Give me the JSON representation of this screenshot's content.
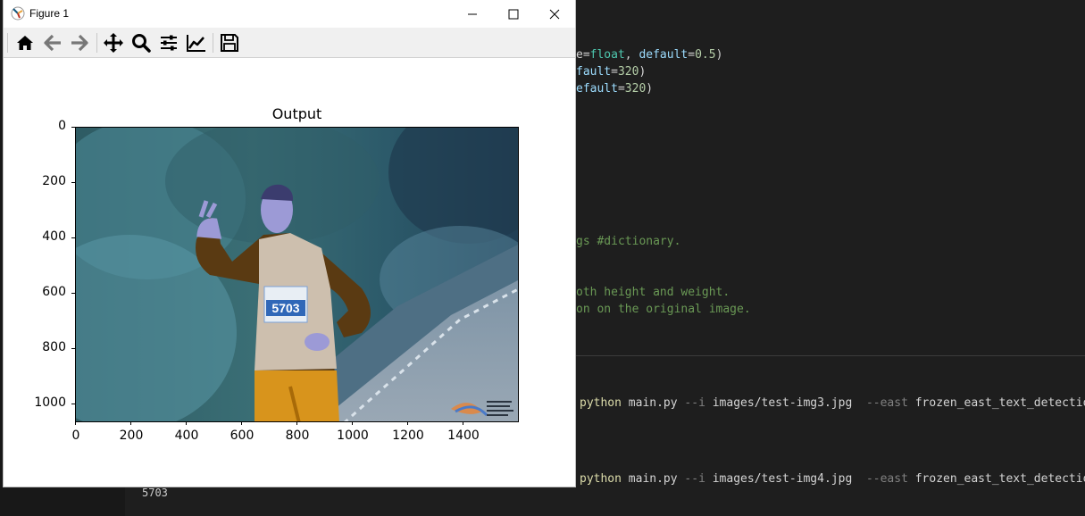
{
  "window": {
    "title": "Figure 1",
    "minimize_icon": "minimize-icon",
    "maximize_icon": "maximize-icon",
    "close_icon": "close-icon"
  },
  "toolbar": {
    "buttons": [
      "home-icon",
      "back-arrow-icon",
      "forward-arrow-icon",
      "pan-icon",
      "zoom-icon",
      "subplots-icon",
      "axes-edit-icon",
      "save-icon"
    ]
  },
  "plot": {
    "title": "Output",
    "yticks": [
      "0",
      "200",
      "400",
      "600",
      "800",
      "1000"
    ],
    "xticks": [
      "0",
      "200",
      "400",
      "600",
      "800",
      "1000",
      "1200",
      "1400"
    ],
    "bib_number": "5703"
  },
  "editor": {
    "lines": [
      {
        "parts": [
          [
            "e=",
            ""
          ],
          [
            "float",
            "kw"
          ],
          [
            ", ",
            ""
          ],
          [
            "default",
            "param"
          ],
          [
            "=",
            ""
          ],
          [
            "0.5",
            "num"
          ],
          [
            ")",
            ""
          ]
        ]
      },
      {
        "parts": [
          [
            "fault",
            "param"
          ],
          [
            "=",
            ""
          ],
          [
            "320",
            "num"
          ],
          [
            ")",
            ""
          ]
        ]
      },
      {
        "parts": [
          [
            "efault",
            "param"
          ],
          [
            "=",
            ""
          ],
          [
            "320",
            "num"
          ],
          [
            ")",
            ""
          ]
        ]
      },
      {
        "parts": [
          [
            "gs #dictionary.",
            "cmt"
          ]
        ]
      },
      {
        "parts": [
          [
            "oth height and weight.",
            "cmt"
          ]
        ]
      },
      {
        "parts": [
          [
            "on on the original image.",
            "cmt"
          ]
        ]
      }
    ],
    "terminal": [
      {
        "cmd": "python",
        "args": "main.py",
        "flag1": "--i",
        "file": "images/test-img3.jpg",
        "flag2": "--east",
        "model": "frozen_east_text_detection.pb"
      },
      {
        "cmd": "python",
        "args": "main.py",
        "flag1": "--i",
        "file": "images/test-img4.jpg",
        "flag2": "--east",
        "model": "frozen_east_text_detection.pb"
      }
    ],
    "output": "5703"
  },
  "colors": {
    "editor_bg": "#1e1e1e",
    "toolbar_bg": "#f0f0f0",
    "accent_yellow": "#dcdcaa",
    "comment_green": "#6a9955"
  }
}
